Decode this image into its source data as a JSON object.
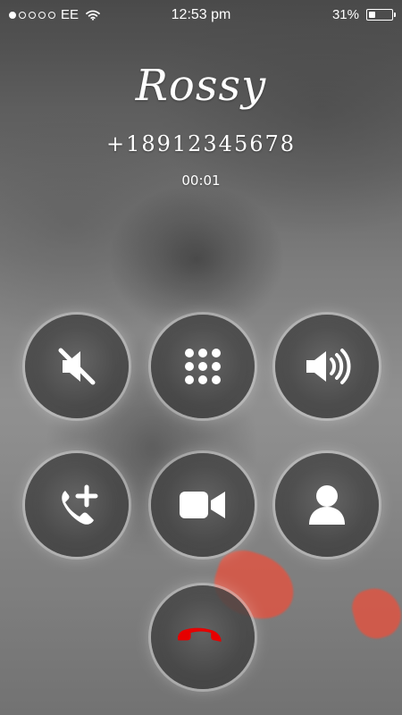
{
  "status_bar": {
    "carrier": "EE",
    "time": "12:53 pm",
    "battery_percent": "31%",
    "battery_level": 0.31,
    "signal_strength": 1,
    "wifi_icon": "wifi-icon",
    "battery_icon": "battery-icon"
  },
  "call": {
    "name": "Rossy",
    "number": "+18912345678",
    "duration": "00:01"
  },
  "actions": {
    "mute_icon": "mute-icon",
    "keypad_icon": "keypad-icon",
    "speaker_icon": "speaker-icon",
    "add_call_icon": "add-call-icon",
    "video_icon": "video-call-icon",
    "contacts_icon": "contacts-icon",
    "end_call_icon": "end-call-icon"
  },
  "colors": {
    "end_call": "#e60000"
  }
}
